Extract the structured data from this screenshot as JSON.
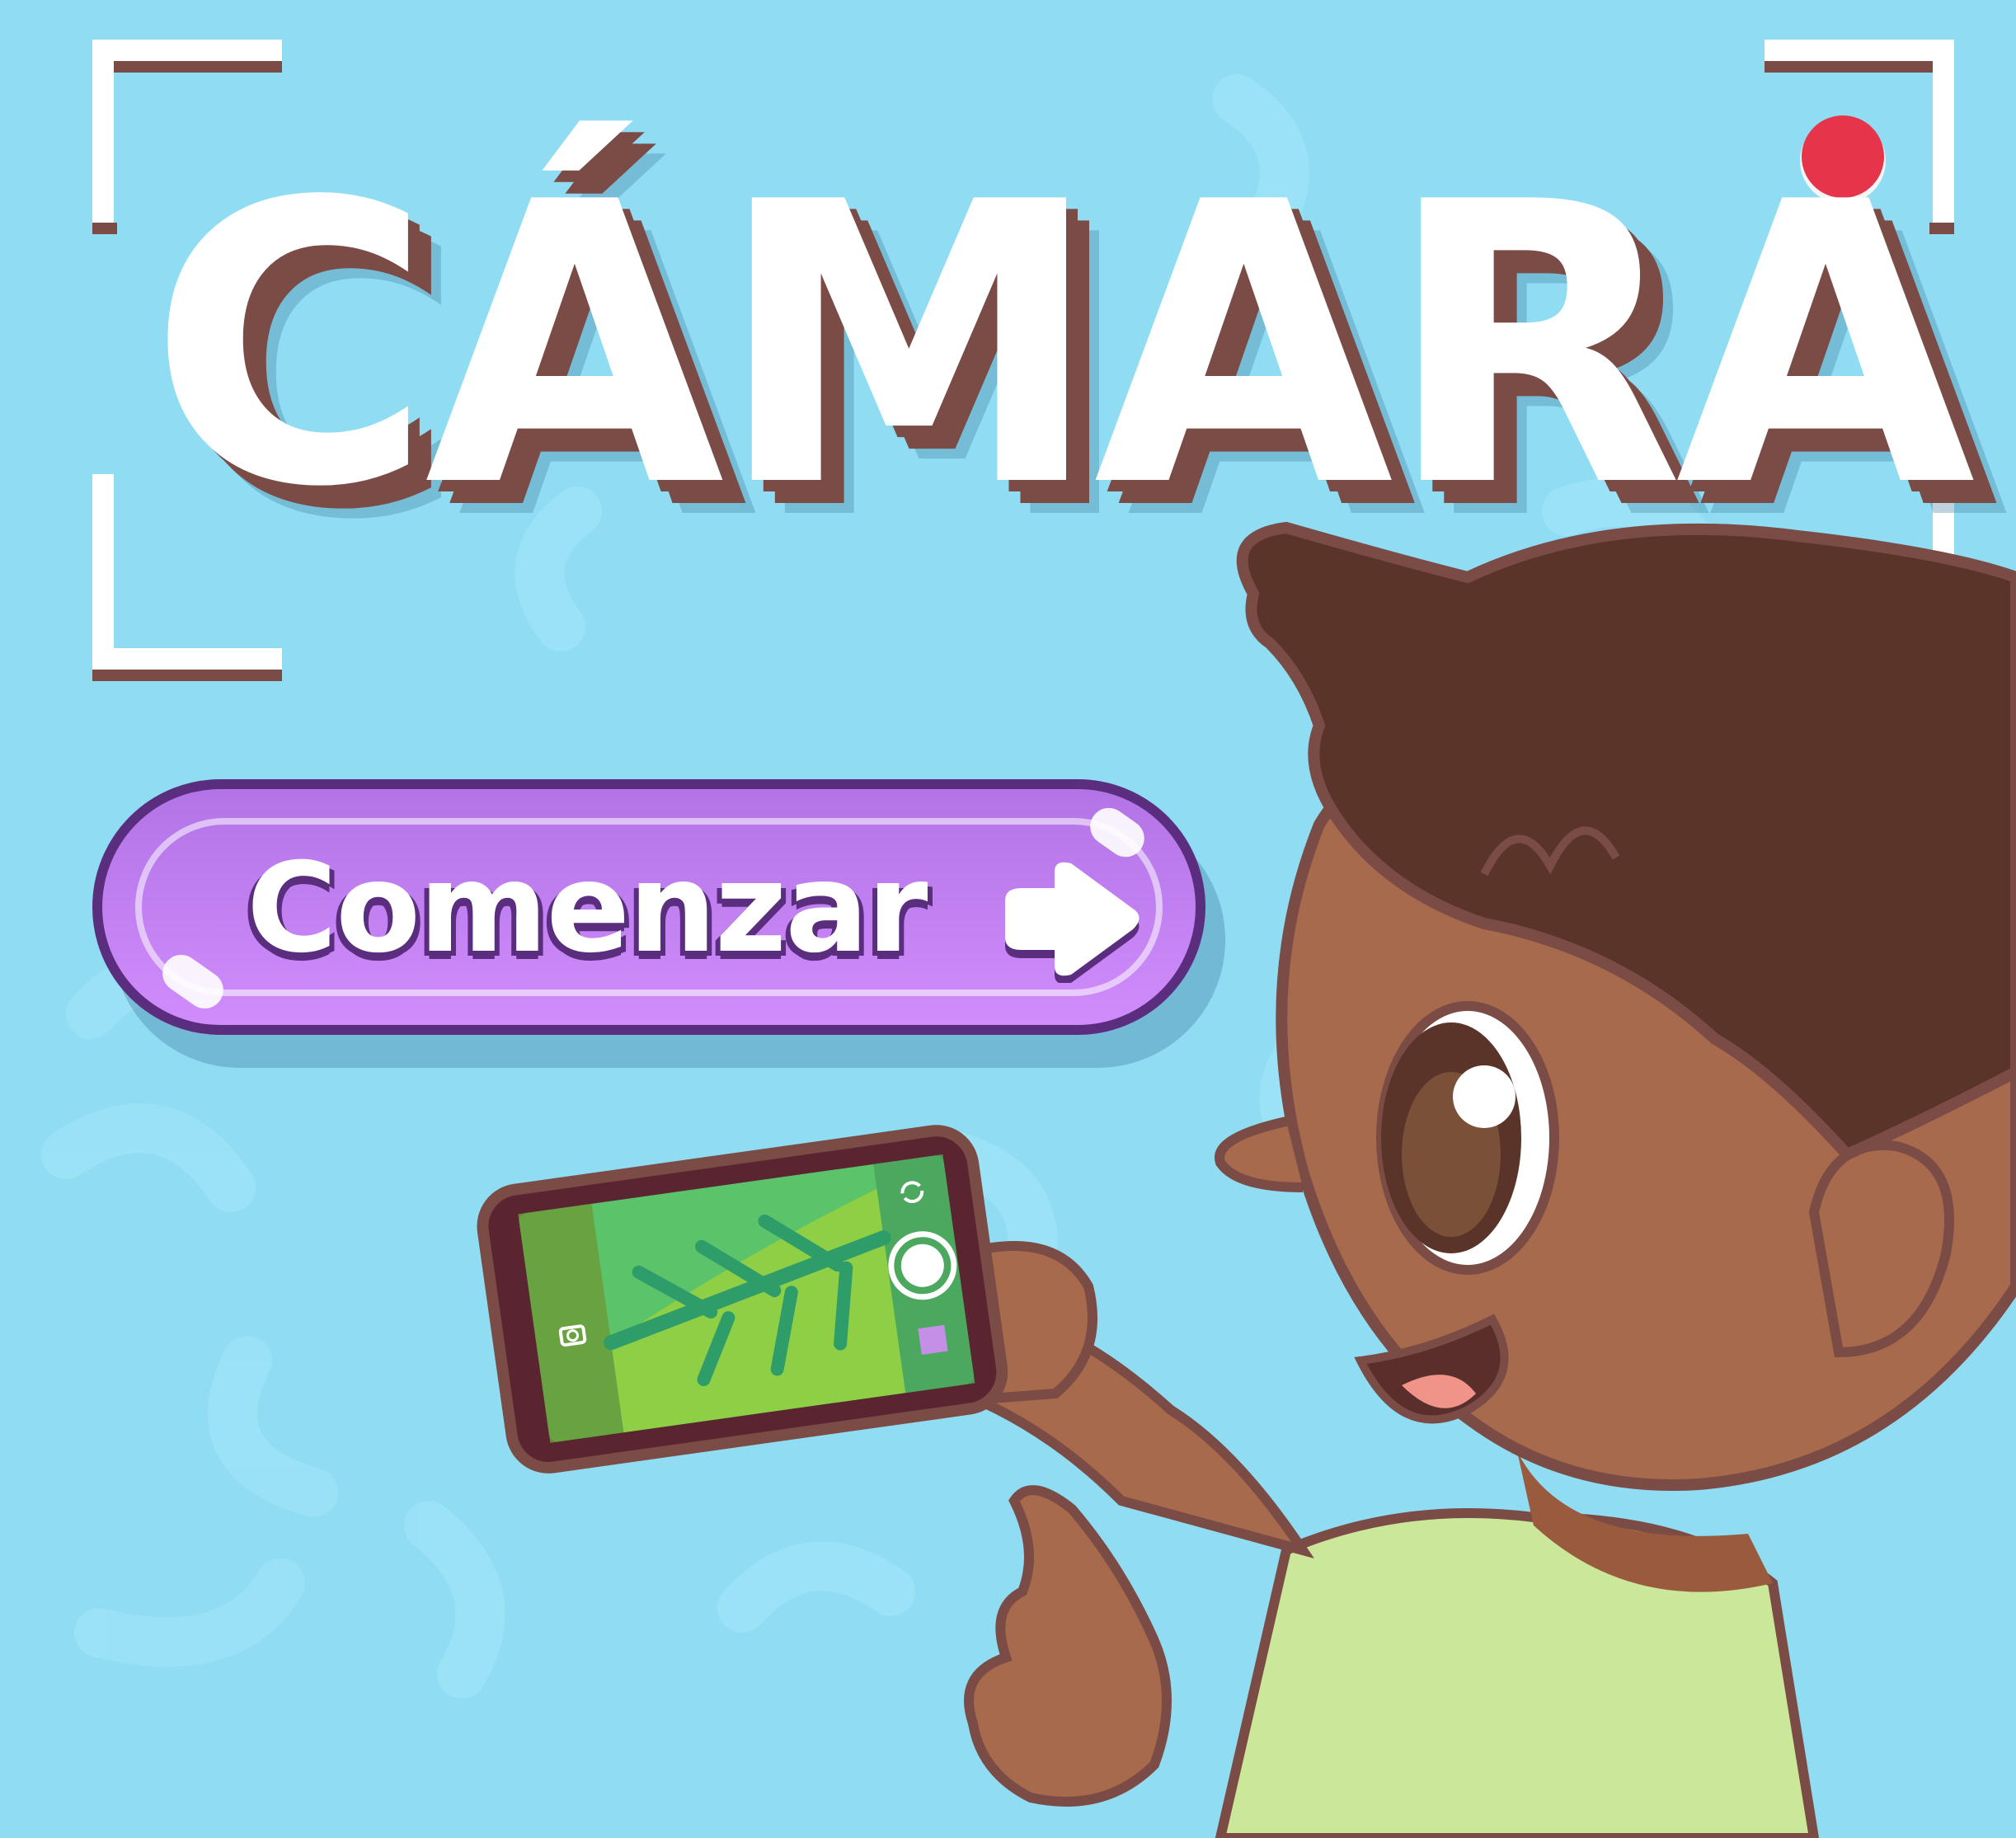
{
  "screen": {
    "title": "CÁMARA",
    "start_button": {
      "label": "Comenzar",
      "icon": "arrow-right-icon"
    },
    "record_indicator": {
      "icon": "record-dot-icon",
      "color": "#e6344a"
    }
  },
  "phone": {
    "preview_subject": "leaf",
    "controls": [
      "switch-camera-icon",
      "shutter-button-icon",
      "camera-icon",
      "gallery-thumbnail-icon"
    ]
  },
  "colors": {
    "background": "#8fdcf3",
    "title_fill": "#ffffff",
    "title_outline": "#7b4c45",
    "button_fill": "#c283f4",
    "button_border": "#5b2d7e",
    "record": "#e6344a"
  }
}
